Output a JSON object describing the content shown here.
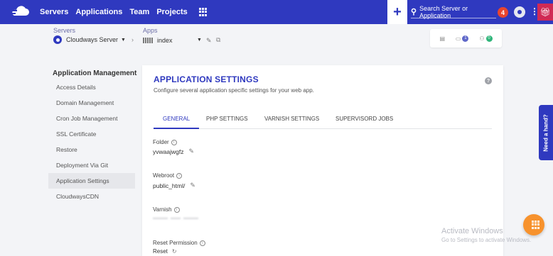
{
  "nav": {
    "items": [
      "Servers",
      "Applications",
      "Team",
      "Projects"
    ],
    "search_label": "Search Server or Application",
    "notifications_count": "4",
    "colors": {
      "bar": "#2f39bf",
      "notification": "#e8452f",
      "gift": "#d02a55"
    }
  },
  "subheader": {
    "servers_label": "Servers",
    "server_name": "Cloudways Server",
    "apps_label": "Apps",
    "app_name": "index",
    "toolbar": {
      "first_count": "1",
      "second_count": "0"
    }
  },
  "sidebar": {
    "heading": "Application Management",
    "items": [
      {
        "label": "Access Details"
      },
      {
        "label": "Domain Management"
      },
      {
        "label": "Cron Job Management"
      },
      {
        "label": "SSL Certificate"
      },
      {
        "label": "Restore"
      },
      {
        "label": "Deployment Via Git"
      },
      {
        "label": "Application Settings"
      },
      {
        "label": "CloudwaysCDN"
      }
    ],
    "active_index": 6
  },
  "main": {
    "title": "APPLICATION SETTINGS",
    "subtitle": "Configure several application specific settings for your web app.",
    "tabs": [
      "GENERAL",
      "PHP SETTINGS",
      "VARNISH SETTINGS",
      "SUPERVISORD JOBS"
    ],
    "active_tab": 0,
    "fields": {
      "folder": {
        "label": "Folder",
        "value": "yvwaajwgfz"
      },
      "webroot": {
        "label": "Webroot",
        "value": "public_html/"
      },
      "varnish": {
        "label": "Varnish"
      },
      "reset_permission": {
        "label": "Reset Permission",
        "value": "Reset"
      }
    }
  },
  "help_tab": "Need a hand?",
  "watermark": {
    "title": "Activate Windows",
    "subtitle": "Go to Settings to activate Windows."
  },
  "fab_color": "#f7922d"
}
